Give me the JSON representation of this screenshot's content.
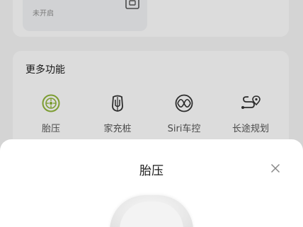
{
  "top_card": {
    "status_text": "未开启"
  },
  "more_features": {
    "title": "更多功能",
    "items": [
      {
        "label": "胎压",
        "icon": "tire-pressure-icon",
        "color": "#8fb33a"
      },
      {
        "label": "家充桩",
        "icon": "charging-pile-icon",
        "color": "#333333"
      },
      {
        "label": "Siri车控",
        "icon": "siri-control-icon",
        "color": "#333333"
      },
      {
        "label": "长途规划",
        "icon": "route-planning-icon",
        "color": "#333333"
      }
    ]
  },
  "sheet": {
    "title": "胎压"
  }
}
